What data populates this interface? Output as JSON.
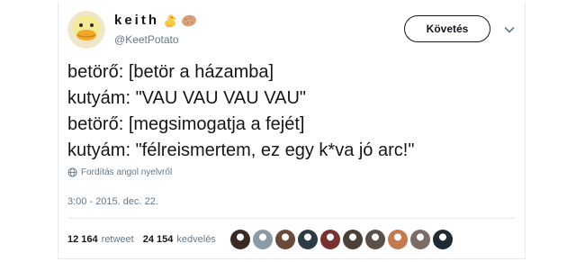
{
  "user": {
    "display_name": "keith",
    "handle": "@KeetPotato",
    "name_emojis": [
      "chick-icon",
      "potato-icon"
    ]
  },
  "header": {
    "follow_label": "Követés",
    "more_icon": "chevron-down-icon"
  },
  "tweet": {
    "lines": [
      "betörő: [betör a házamba]",
      "kutyám: \"VAU VAU VAU VAU\"",
      "betörő: [megsimogatja a fejét]",
      "kutyám: \"félreismertem, ez egy k*va jó arc!\""
    ],
    "translate_label": "Fordítás angol nyelvről",
    "timestamp": "3:00 - 2015. dec. 22."
  },
  "stats": {
    "retweet_count": "12 164",
    "retweet_label": "retweet",
    "like_count": "24 154",
    "like_label": "kedvelés"
  },
  "likers": [
    {
      "color": "#3b2a22"
    },
    {
      "color": "#8a9aa6"
    },
    {
      "color": "#6b4a3a"
    },
    {
      "color": "#2f3b44"
    },
    {
      "color": "#7a3030"
    },
    {
      "color": "#4a4036"
    },
    {
      "color": "#5a5048"
    },
    {
      "color": "#c47a50"
    },
    {
      "color": "#7d6c66"
    },
    {
      "color": "#1f2a33"
    }
  ],
  "colors": {
    "text_primary": "#14171a",
    "text_secondary": "#657786",
    "border": "#e6ecf0"
  }
}
